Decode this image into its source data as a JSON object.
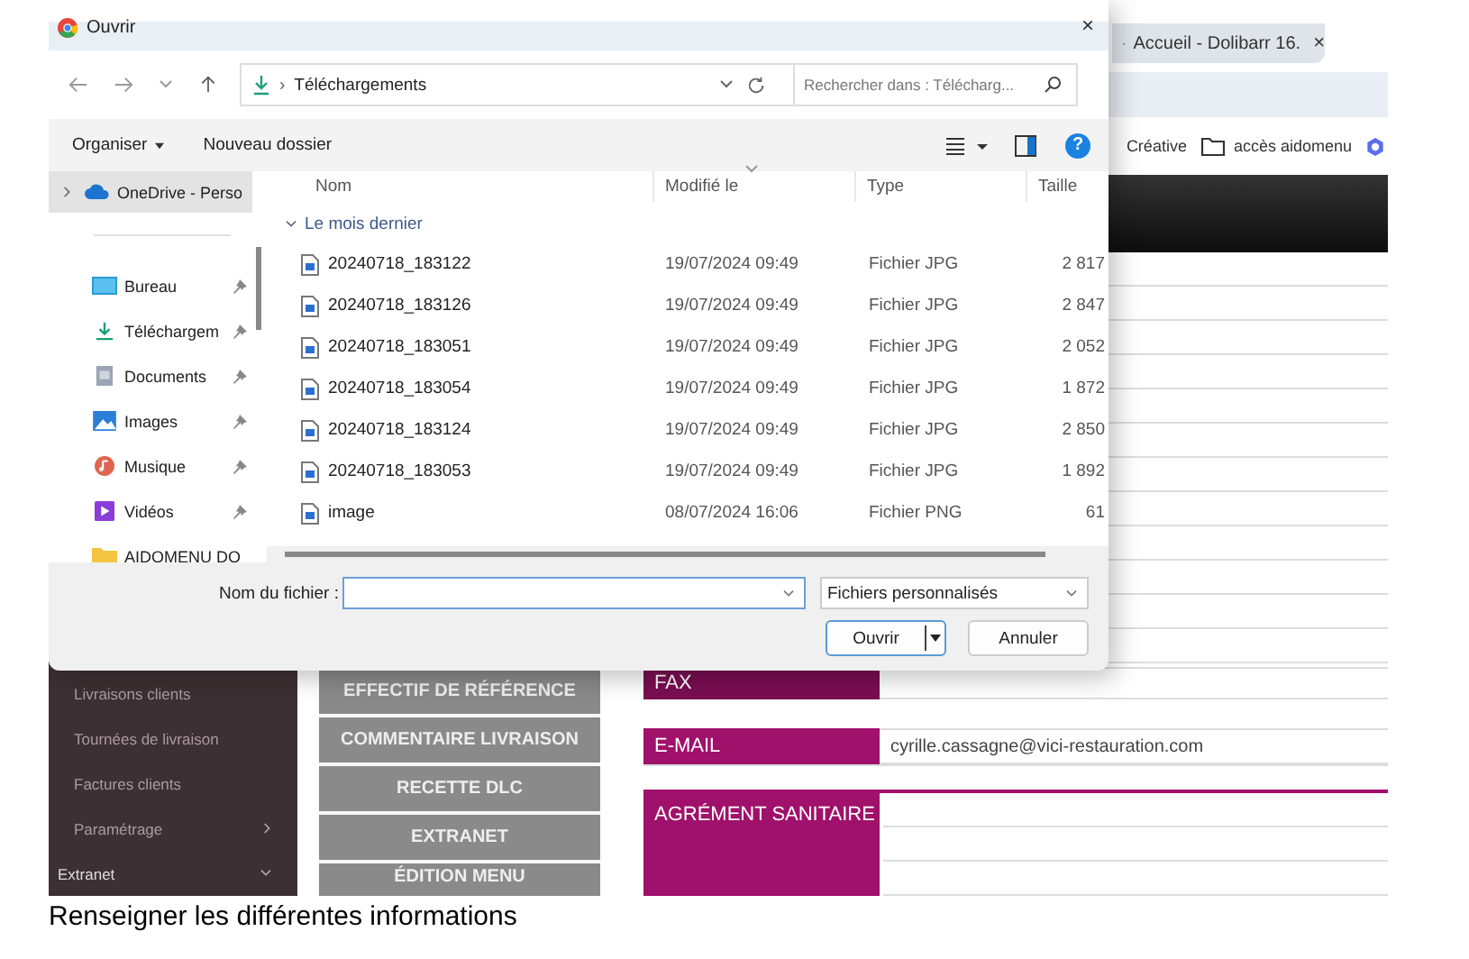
{
  "browser": {
    "tab": {
      "title": "Accueil - Dolibarr 16.",
      "close": "×"
    },
    "bookmarks": [
      {
        "label": "Créative",
        "kind": "text"
      },
      {
        "label": "accès aidomenu",
        "kind": "folder"
      },
      {
        "kind": "extension"
      }
    ],
    "sidebar": [
      {
        "label": "Livraisons clients",
        "kind": "link"
      },
      {
        "label": "Tournées de livraison",
        "kind": "link"
      },
      {
        "label": "Factures clients",
        "kind": "link"
      },
      {
        "label": "Paramétrage",
        "kind": "submenu"
      },
      {
        "label": "Extranet",
        "kind": "section"
      }
    ],
    "buttons": [
      "EFFECTIF DE RÉFÉRENCE",
      "COMMENTAIRE LIVRAISON",
      "RECETTE DLC",
      "EXTRANET",
      "ÉDITION MENU"
    ],
    "form": [
      {
        "label": "FAX",
        "kind": "short"
      },
      {
        "label": "E-MAIL",
        "kind": "short",
        "value": "cyrille.cassagne@vici-restauration.com"
      },
      {
        "label": "AGRÉMENT SANITAIRE",
        "kind": "block"
      }
    ]
  },
  "dialog": {
    "title": "Ouvrir",
    "close": "×",
    "path": {
      "separator": "›",
      "folder": "Téléchargements"
    },
    "search": {
      "placeholder": "Rechercher dans : Télécharg..."
    },
    "toolbar": {
      "organize": "Organiser",
      "new_folder": "Nouveau dossier",
      "help": "?"
    },
    "sidebar": [
      {
        "label": "OneDrive - Perso",
        "kind": "cloud",
        "selected": true,
        "pinned": false
      },
      {
        "label": "Bureau",
        "kind": "desktop",
        "selected": false,
        "pinned": true
      },
      {
        "label": "Téléchargem",
        "kind": "download",
        "selected": false,
        "pinned": true
      },
      {
        "label": "Documents",
        "kind": "documents",
        "selected": false,
        "pinned": true
      },
      {
        "label": "Images",
        "kind": "pictures",
        "selected": false,
        "pinned": true
      },
      {
        "label": "Musique",
        "kind": "music",
        "selected": false,
        "pinned": true
      },
      {
        "label": "Vidéos",
        "kind": "videos",
        "selected": false,
        "pinned": true
      },
      {
        "label": "AIDOMENU DO",
        "kind": "folder",
        "selected": false,
        "pinned": false
      }
    ],
    "columns": [
      {
        "label": "Nom",
        "sorted": false
      },
      {
        "label": "Modifié le",
        "sorted": true
      },
      {
        "label": "Type",
        "sorted": false
      },
      {
        "label": "Taille",
        "sorted": false
      }
    ],
    "group": "Le mois dernier",
    "files": [
      {
        "name": "20240718_183122",
        "modified": "19/07/2024 09:49",
        "type": "Fichier JPG",
        "size": "2 817"
      },
      {
        "name": "20240718_183126",
        "modified": "19/07/2024 09:49",
        "type": "Fichier JPG",
        "size": "2 847"
      },
      {
        "name": "20240718_183051",
        "modified": "19/07/2024 09:49",
        "type": "Fichier JPG",
        "size": "2 052"
      },
      {
        "name": "20240718_183054",
        "modified": "19/07/2024 09:49",
        "type": "Fichier JPG",
        "size": "1 872"
      },
      {
        "name": "20240718_183124",
        "modified": "19/07/2024 09:49",
        "type": "Fichier JPG",
        "size": "2 850"
      },
      {
        "name": "20240718_183053",
        "modified": "19/07/2024 09:49",
        "type": "Fichier JPG",
        "size": "1 892"
      },
      {
        "name": "image",
        "modified": "08/07/2024 16:06",
        "type": "Fichier PNG",
        "size": "61"
      }
    ],
    "file_name": {
      "label": "Nom du fichier :"
    },
    "file_type": "Fichiers personnalisés",
    "buttons": [
      "Ouvrir",
      "Annuler"
    ]
  },
  "caption": "Renseigner les différentes informations"
}
